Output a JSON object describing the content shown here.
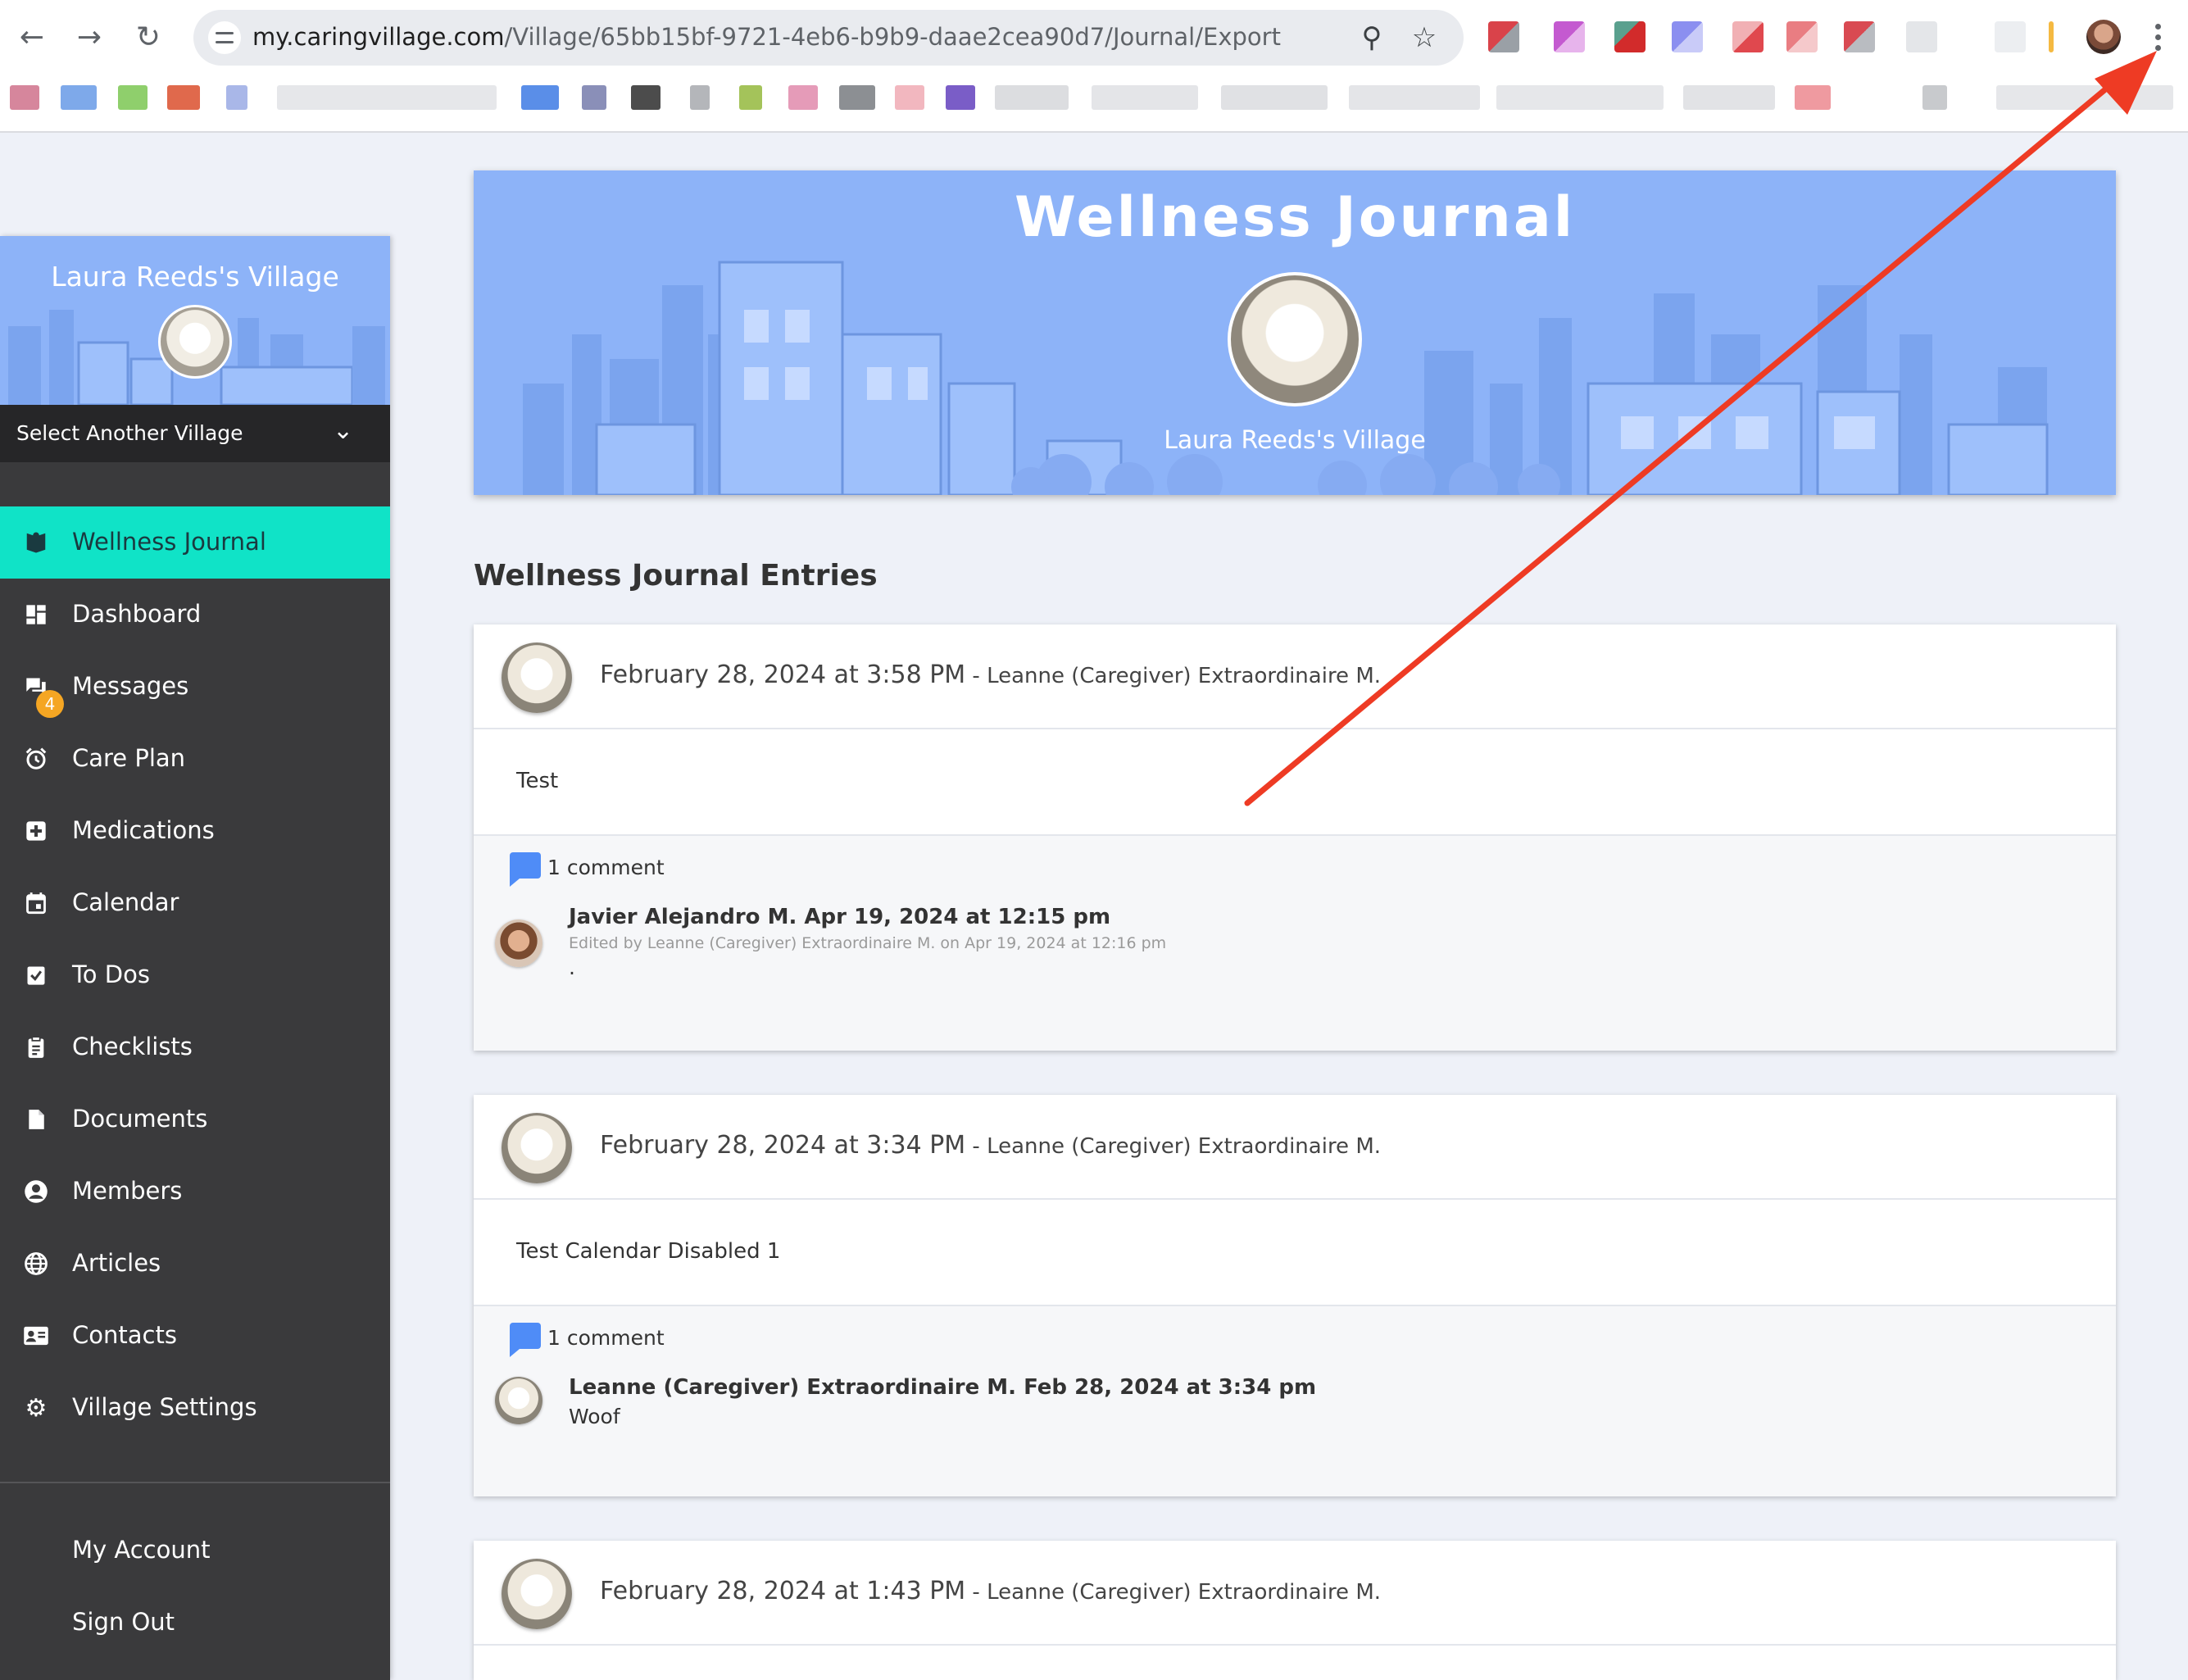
{
  "browser": {
    "url_host": "my.caringvillage.com",
    "url_path": "/Village/65bb15bf-9721-4eb6-b9b9-daae2cea90d7/Journal/Export",
    "colors": {
      "bar": "#ffffff",
      "omnibox": "#e9ebef"
    }
  },
  "sidebar": {
    "village_title": "Laura Reeds's Village",
    "select_village_label": "Select Another Village",
    "active_color": "#10e3c7",
    "menu": [
      {
        "label": "Wellness Journal",
        "icon": "journal-icon",
        "active": true
      },
      {
        "label": "Dashboard",
        "icon": "dashboard-icon"
      },
      {
        "label": "Messages",
        "icon": "messages-icon",
        "badge": "4"
      },
      {
        "label": "Care Plan",
        "icon": "alarm-clock-icon"
      },
      {
        "label": "Medications",
        "icon": "medical-plus-icon"
      },
      {
        "label": "Calendar",
        "icon": "calendar-icon"
      },
      {
        "label": "To Dos",
        "icon": "todo-check-icon"
      },
      {
        "label": "Checklists",
        "icon": "clipboard-icon"
      },
      {
        "label": "Documents",
        "icon": "document-icon"
      },
      {
        "label": "Members",
        "icon": "person-circle-icon"
      },
      {
        "label": "Articles",
        "icon": "globe-icon"
      },
      {
        "label": "Contacts",
        "icon": "contact-card-icon"
      },
      {
        "label": "Village Settings",
        "icon": "gear-icon"
      }
    ],
    "account_links": [
      "My Account",
      "Sign Out"
    ]
  },
  "hero": {
    "title": "Wellness Journal",
    "subtitle": "Laura Reeds's Village",
    "background": "#8db3f8"
  },
  "section_title": "Wellness Journal Entries",
  "entries": [
    {
      "date": "February 28, 2024 at 3:58 PM",
      "author": " - Leanne (Caregiver) Extraordinaire M.",
      "body": "Test",
      "comment_count": "1 comment",
      "comment": {
        "author": "Javier Alejandro M. Apr 19, 2024 at 12:15 pm",
        "edited": "Edited by Leanne (Caregiver) Extraordinaire M. on Apr 19, 2024 at 12:16 pm",
        "text": "."
      }
    },
    {
      "date": "February 28, 2024 at 3:34 PM",
      "author": " - Leanne (Caregiver) Extraordinaire M.",
      "body": "Test Calendar Disabled 1",
      "comment_count": "1 comment",
      "comment": {
        "author": "Leanne (Caregiver) Extraordinaire M. Feb 28, 2024 at 3:34 pm",
        "text": "Woof"
      }
    },
    {
      "date": "February 28, 2024 at 1:43 PM",
      "author": " - Leanne (Caregiver) Extraordinaire M."
    }
  ],
  "annotation": {
    "arrow_color": "#ee3b24"
  }
}
